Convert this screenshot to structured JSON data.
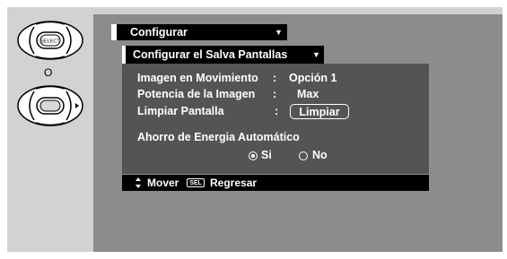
{
  "remote": {
    "select_label": "SELECT",
    "or_label": "O"
  },
  "menu": {
    "title": "Configurar",
    "submenu": "Configurar el Salva Pantallas"
  },
  "settings": [
    {
      "label": "Imagen en Movimiento",
      "value": "Opción 1"
    },
    {
      "label": "Potencia de la Imagen",
      "value": "Max"
    },
    {
      "label": "Limpiar Pantalla",
      "button": "Limpiar"
    }
  ],
  "auto_save": {
    "label": "Ahorro de Energia Automático",
    "option_yes": "Si",
    "option_no": "No",
    "selected": "Si"
  },
  "footer": {
    "move_label": "Mover",
    "sel_key": "SEL",
    "back_label": "Regresar"
  },
  "colors": {
    "panel": "#545454",
    "screen": "#8c8c8c",
    "frame": "#d2d2d2"
  }
}
